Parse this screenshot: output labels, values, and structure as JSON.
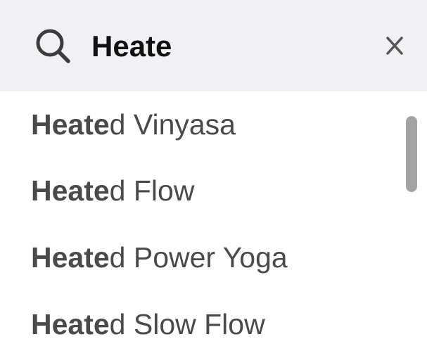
{
  "search": {
    "value": "Heate",
    "icon": "search-icon",
    "clear_label": "X"
  },
  "suggestions": [
    {
      "match": "Heate",
      "rest": "d Vinyasa"
    },
    {
      "match": "Heate",
      "rest": "d Flow"
    },
    {
      "match": "Heate",
      "rest": "d Power Yoga"
    },
    {
      "match": "Heate",
      "rest": "d Slow Flow"
    }
  ],
  "colors": {
    "search_bar_bg": "#f0f1f5",
    "text": "#4a4a4a",
    "input_text": "#111111",
    "scrollbar": "#a3a3a3"
  }
}
